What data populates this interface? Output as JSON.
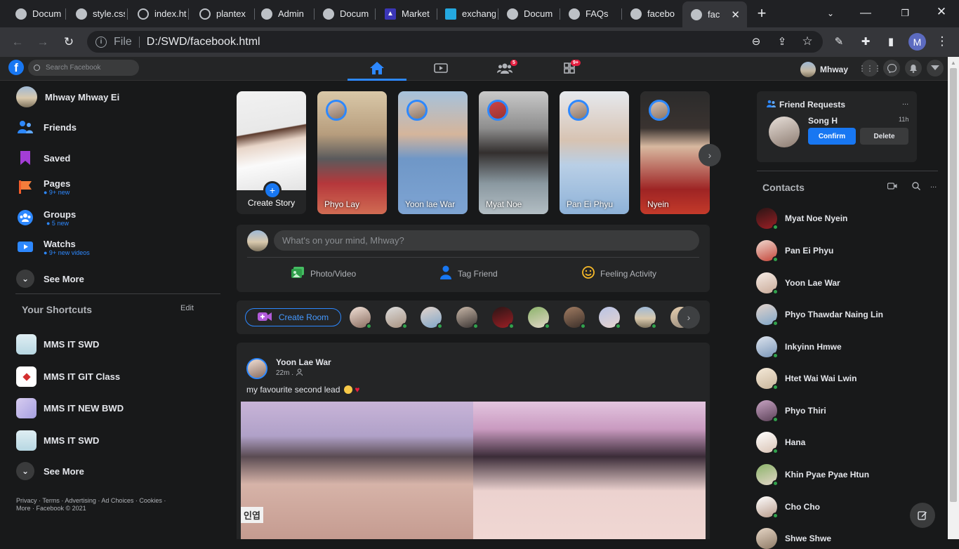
{
  "browser": {
    "tabs": [
      {
        "title": "Docum",
        "icon": "globe-icon"
      },
      {
        "title": "style.css",
        "icon": "globe-icon"
      },
      {
        "title": "index.ht",
        "icon": "leaf-icon"
      },
      {
        "title": "plantex",
        "icon": "leaf-icon"
      },
      {
        "title": "Admin",
        "icon": "globe-icon"
      },
      {
        "title": "Docum",
        "icon": "globe-icon"
      },
      {
        "title": "Market",
        "icon": "market-icon"
      },
      {
        "title": "exchang",
        "icon": "exchange-icon"
      },
      {
        "title": "Docum",
        "icon": "globe-icon"
      },
      {
        "title": "FAQs",
        "icon": "globe-icon"
      },
      {
        "title": "facebo",
        "icon": "globe-icon"
      },
      {
        "title": "fac",
        "icon": "globe-icon",
        "active": true
      }
    ],
    "address": {
      "scheme": "File",
      "url": "D:/SWD/facebook.html"
    },
    "profile_initial": "M"
  },
  "fb_header": {
    "logo": "f",
    "search_placeholder": "Search Facebook",
    "friends_badge": "5",
    "menu_badge": "9+",
    "user_name": "Mhway"
  },
  "left_sidebar": {
    "profile_name": "Mhway Mhway Ei",
    "items": [
      {
        "label": "Friends",
        "sub": ""
      },
      {
        "label": "Saved",
        "sub": ""
      },
      {
        "label": "Pages",
        "sub": "● 9+ new"
      },
      {
        "label": "Groups",
        "sub": "● 5 new"
      },
      {
        "label": "Watchs",
        "sub": "● 9+ new videos"
      }
    ],
    "see_more": "See More",
    "shortcuts_title": "Your Shortcuts",
    "shortcuts_edit": "Edit",
    "shortcuts": [
      "MMS IT SWD",
      "MMS IT GIT Class",
      "MMS IT NEW BWD",
      "MMS IT SWD"
    ],
    "see_more_2": "See More",
    "footer_line1": "Privacy · Terms · Advertising · Ad Choices ·    Cookies ·",
    "footer_line2": "More · Facebook © 2021"
  },
  "stories": {
    "create_label": "Create Story",
    "items": [
      "Phyo Lay",
      "Yoon lae War",
      "Myat Noe",
      "Pan Ei Phyu",
      "Nyein"
    ],
    "next": "›"
  },
  "composer": {
    "placeholder": "What's on your mind, Mhway?",
    "photo_video": "Photo/Video",
    "tag_friend": "Tag Friend",
    "feeling": "Feeling Activity"
  },
  "rooms": {
    "create_room": "Create Room",
    "next": "›"
  },
  "post": {
    "author": "Yoon Lae War",
    "time": "22m .",
    "text": "my favourite second lead",
    "image_text": "인엽"
  },
  "friend_requests": {
    "title": "Friend Requests",
    "more": "...",
    "name": "Song H",
    "time": "11h",
    "confirm": "Confirm",
    "delete": "Delete"
  },
  "contacts": {
    "title": "Contacts",
    "more": "...",
    "list": [
      "Myat Noe Nyein",
      "Pan Ei Phyu",
      "Yoon Lae War",
      "Phyo Thawdar Naing Lin",
      "Inkyinn Hmwe",
      "Htet Wai Wai Lwin",
      "Phyo Thiri",
      "Hana",
      "Khin Pyae Pyae Htun",
      "Cho Cho",
      "Shwe Shwe"
    ]
  },
  "colors": {
    "fb_blue": "#1877f2",
    "accent_blue": "#2d88ff",
    "online_green": "#31a24c",
    "badge_red": "#e41e3f"
  }
}
